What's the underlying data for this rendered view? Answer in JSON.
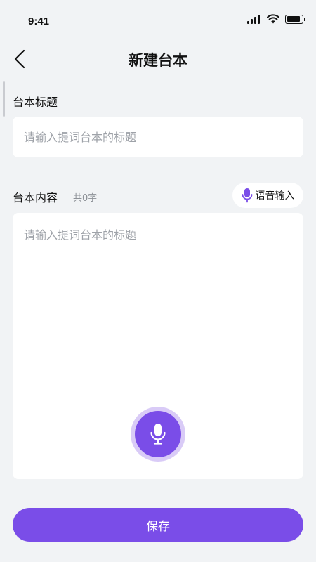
{
  "status_bar": {
    "time": "9:41"
  },
  "header": {
    "title": "新建台本"
  },
  "title_section": {
    "label": "台本标题",
    "placeholder": "请输入提词台本的标题"
  },
  "content_section": {
    "label": "台本内容",
    "char_count": "共0字",
    "voice_input_label": "语音输入",
    "placeholder": "请输入提词台本的标题"
  },
  "footer": {
    "save_label": "保存"
  },
  "colors": {
    "accent": "#7a4de8",
    "accent_light": "#d9cbf7",
    "background": "#f1f3f5"
  }
}
